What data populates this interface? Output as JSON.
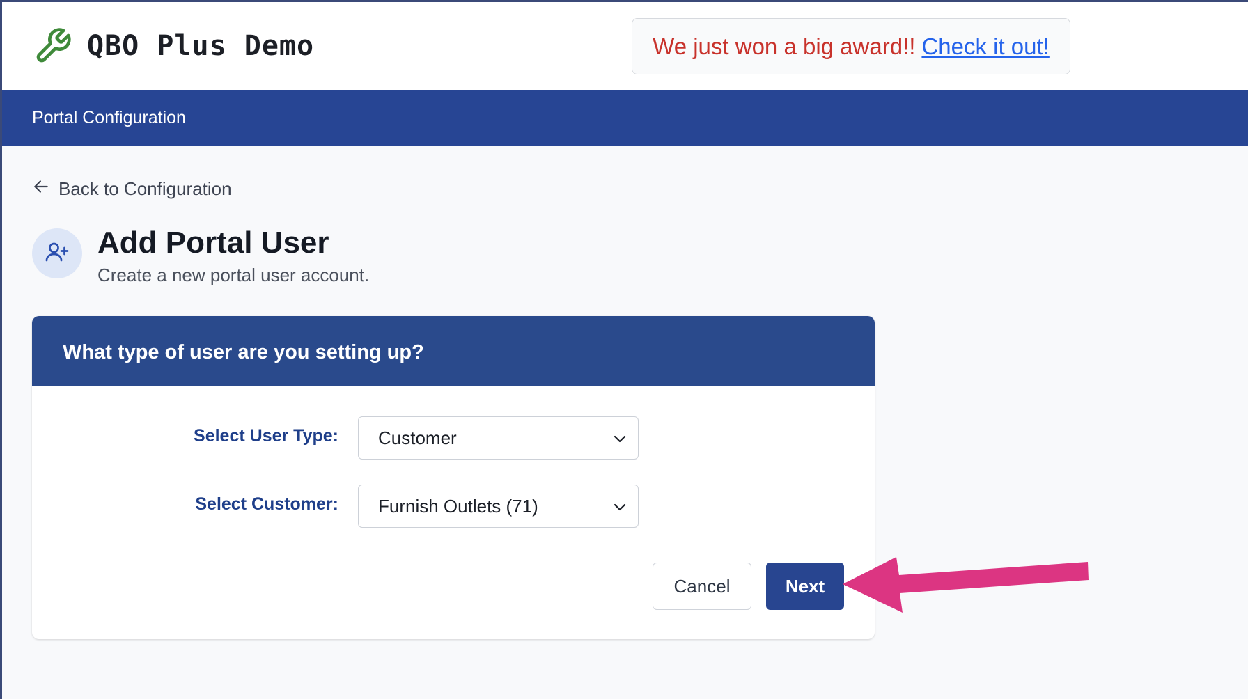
{
  "header": {
    "app_title": "QBO Plus Demo",
    "logo_icon": "wrench-icon",
    "award": {
      "text": "We just won a big award!!",
      "link": "Check it out!"
    }
  },
  "navbar": {
    "title": "Portal Configuration"
  },
  "back_link": {
    "label": "Back to Configuration",
    "icon": "arrow-left-icon"
  },
  "page": {
    "title": "Add Portal User",
    "subtitle": "Create a new portal user account.",
    "icon": "user-plus-icon"
  },
  "card": {
    "title": "What type of user are you setting up?",
    "fields": [
      {
        "label": "Select User Type:",
        "value": "Customer"
      },
      {
        "label": "Select Customer:",
        "value": "Furnish Outlets (71)"
      }
    ],
    "cancel_label": "Cancel",
    "next_label": "Next"
  },
  "colors": {
    "navbar": "#274594",
    "card_header": "#2a4a8c",
    "award_text": "#c8322b",
    "award_link": "#2563eb",
    "logo_green": "#3f8a3a",
    "annotation_arrow": "#dc3582"
  }
}
